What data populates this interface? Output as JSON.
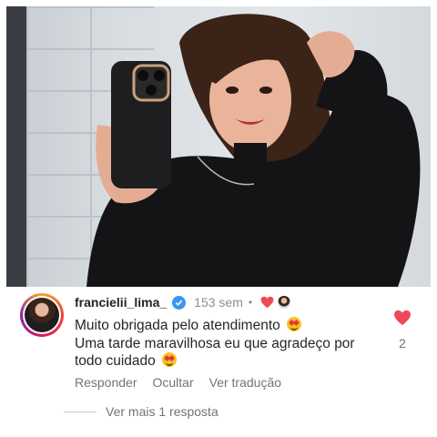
{
  "post": {
    "photo_alt_icon": "selfie-photo"
  },
  "comment": {
    "username": "francielii_lima_",
    "time": "153 sem",
    "separator": "•",
    "line1": "Muito obrigada pelo atendimento",
    "line2": "Uma tarde maravilhosa eu que agradeço por",
    "line3": "todo cuidado",
    "like_count": "2",
    "actions": {
      "reply": "Responder",
      "hide": "Ocultar",
      "translate": "Ver tradução"
    },
    "more_replies": "Ver mais 1 resposta"
  },
  "colors": {
    "heart": "#ed4956",
    "verified": "#3897f0",
    "muted": "#737373"
  }
}
